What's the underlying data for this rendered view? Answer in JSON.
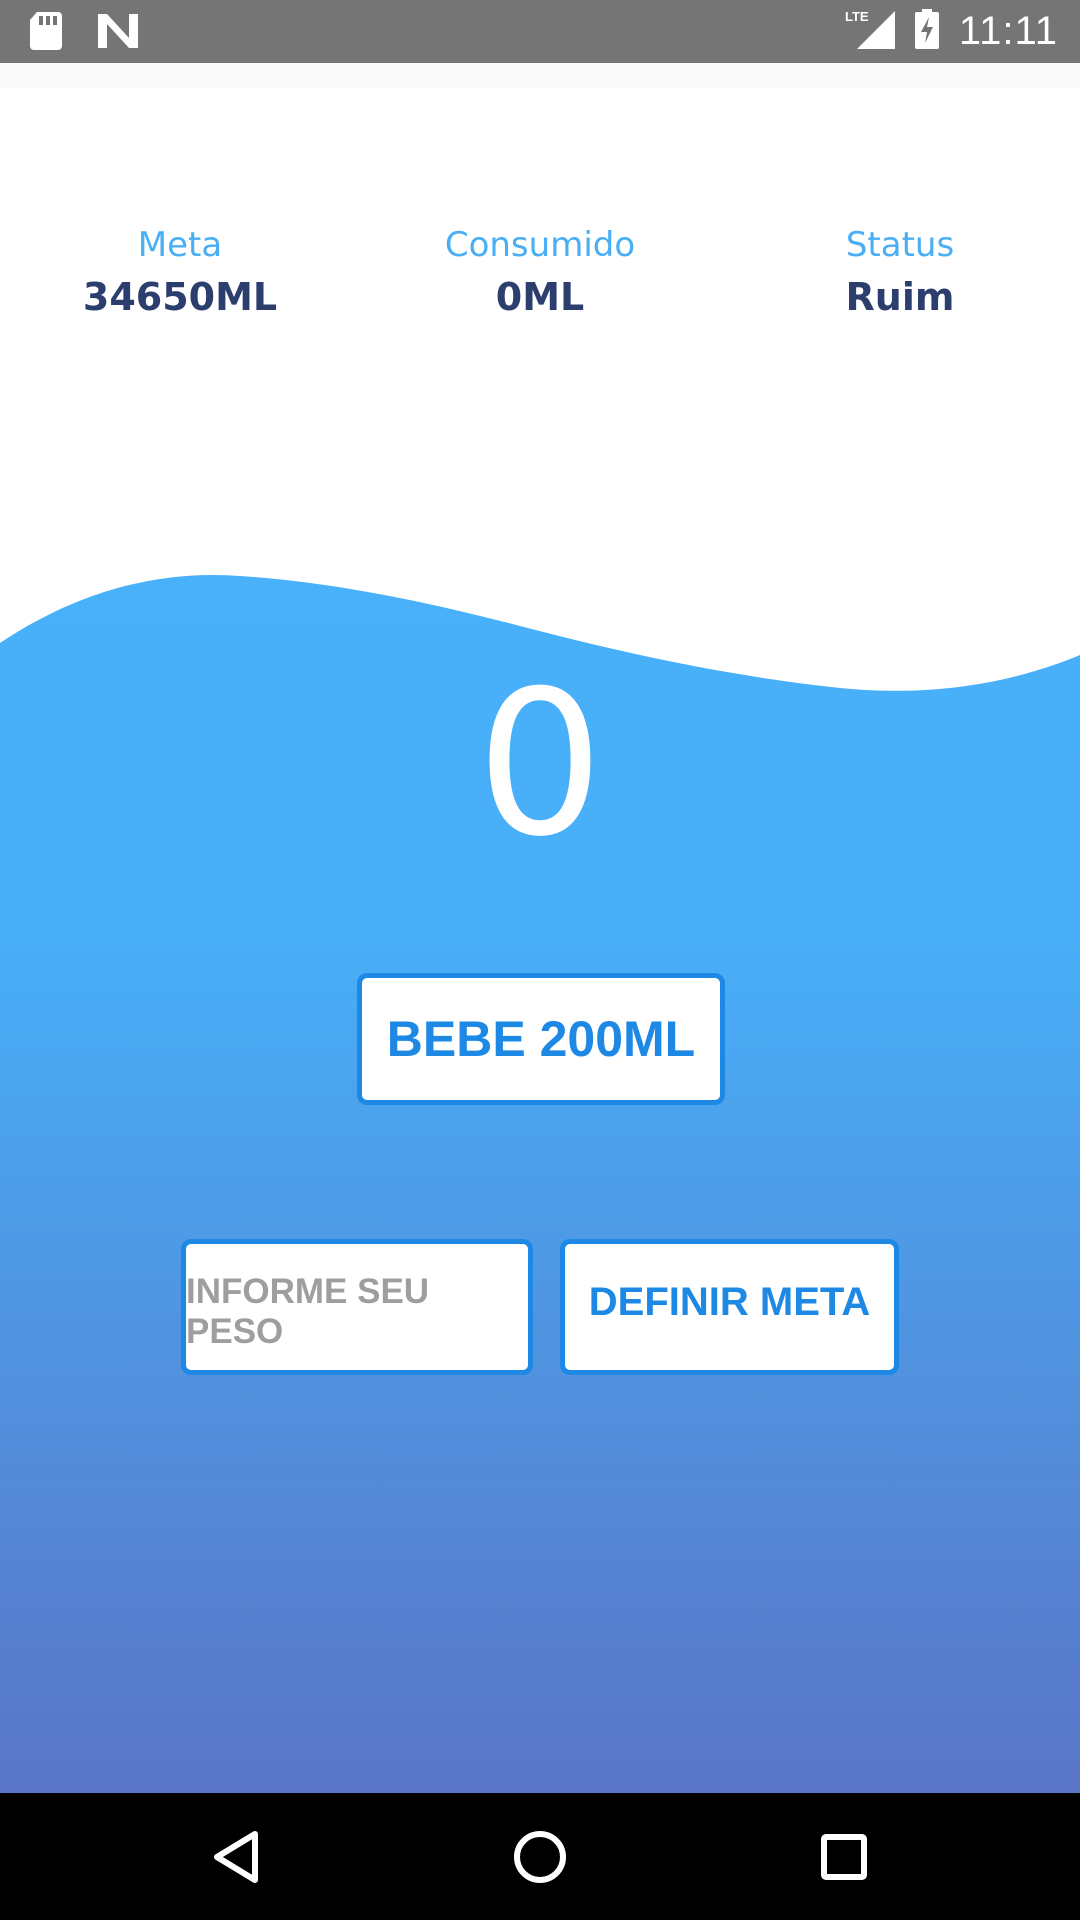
{
  "status_bar": {
    "time": "11:11",
    "network": "LTE",
    "icons": [
      "sd-card-icon",
      "n-notification-icon",
      "lte-signal-icon",
      "battery-charging-icon"
    ]
  },
  "stats": {
    "meta": {
      "label": "Meta",
      "value": "34650ML"
    },
    "consumido": {
      "label": "Consumido",
      "value": "0ML"
    },
    "status": {
      "label": "Status",
      "value": "Ruim"
    }
  },
  "counter": "0",
  "actions": {
    "drink_label": "BEBE 200ML",
    "weight_placeholder": "INFORME SEU PESO",
    "set_goal_label": "DEFINIR META"
  },
  "navigation": {
    "icons": [
      "back-icon",
      "home-icon",
      "recents-icon"
    ]
  },
  "colors": {
    "accent": "#1e88e5",
    "label_blue": "#4aaef5",
    "value_navy": "#2c3e6e",
    "wave_top": "#48b1fa",
    "wave_bottom": "#5a75c6"
  }
}
